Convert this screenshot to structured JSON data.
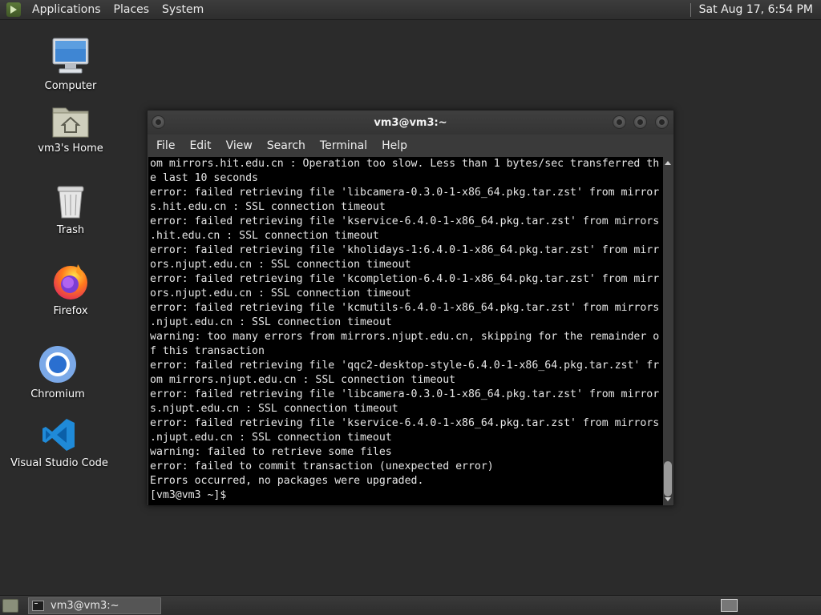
{
  "top_panel": {
    "menus": [
      "Applications",
      "Places",
      "System"
    ],
    "clock": "Sat Aug 17,  6:54 PM"
  },
  "desktop": {
    "icons": [
      {
        "label": "Computer",
        "icon": "computer-icon"
      },
      {
        "label": "vm3's Home",
        "icon": "home-folder-icon"
      },
      {
        "label": "Trash",
        "icon": "trash-icon"
      },
      {
        "label": "Firefox",
        "icon": "firefox-icon"
      },
      {
        "label": "Chromium",
        "icon": "chromium-icon"
      },
      {
        "label": "Visual Studio Code",
        "icon": "vscode-icon"
      }
    ]
  },
  "terminal": {
    "title": "vm3@vm3:~",
    "menus": [
      "File",
      "Edit",
      "View",
      "Search",
      "Terminal",
      "Help"
    ],
    "lines": [
      "om mirrors.hit.edu.cn : Operation too slow. Less than 1 bytes/sec transferred th",
      "e last 10 seconds",
      "error: failed retrieving file 'libcamera-0.3.0-1-x86_64.pkg.tar.zst' from mirror",
      "s.hit.edu.cn : SSL connection timeout",
      "error: failed retrieving file 'kservice-6.4.0-1-x86_64.pkg.tar.zst' from mirrors",
      ".hit.edu.cn : SSL connection timeout",
      "error: failed retrieving file 'kholidays-1:6.4.0-1-x86_64.pkg.tar.zst' from mirr",
      "ors.njupt.edu.cn : SSL connection timeout",
      "error: failed retrieving file 'kcompletion-6.4.0-1-x86_64.pkg.tar.zst' from mirr",
      "ors.njupt.edu.cn : SSL connection timeout",
      "error: failed retrieving file 'kcmutils-6.4.0-1-x86_64.pkg.tar.zst' from mirrors",
      ".njupt.edu.cn : SSL connection timeout",
      "warning: too many errors from mirrors.njupt.edu.cn, skipping for the remainder o",
      "f this transaction",
      "error: failed retrieving file 'qqc2-desktop-style-6.4.0-1-x86_64.pkg.tar.zst' fr",
      "om mirrors.njupt.edu.cn : SSL connection timeout",
      "error: failed retrieving file 'libcamera-0.3.0-1-x86_64.pkg.tar.zst' from mirror",
      "s.njupt.edu.cn : SSL connection timeout",
      "error: failed retrieving file 'kservice-6.4.0-1-x86_64.pkg.tar.zst' from mirrors",
      ".njupt.edu.cn : SSL connection timeout",
      "warning: failed to retrieve some files",
      "error: failed to commit transaction (unexpected error)",
      "Errors occurred, no packages were upgraded.",
      "[vm3@vm3 ~]$ "
    ]
  },
  "bottom_panel": {
    "task_label": "vm3@vm3:~"
  },
  "colors": {
    "desktop_bg": "#2b2b2b",
    "terminal_bg": "#000000",
    "terminal_fg": "#e6e6e6"
  }
}
